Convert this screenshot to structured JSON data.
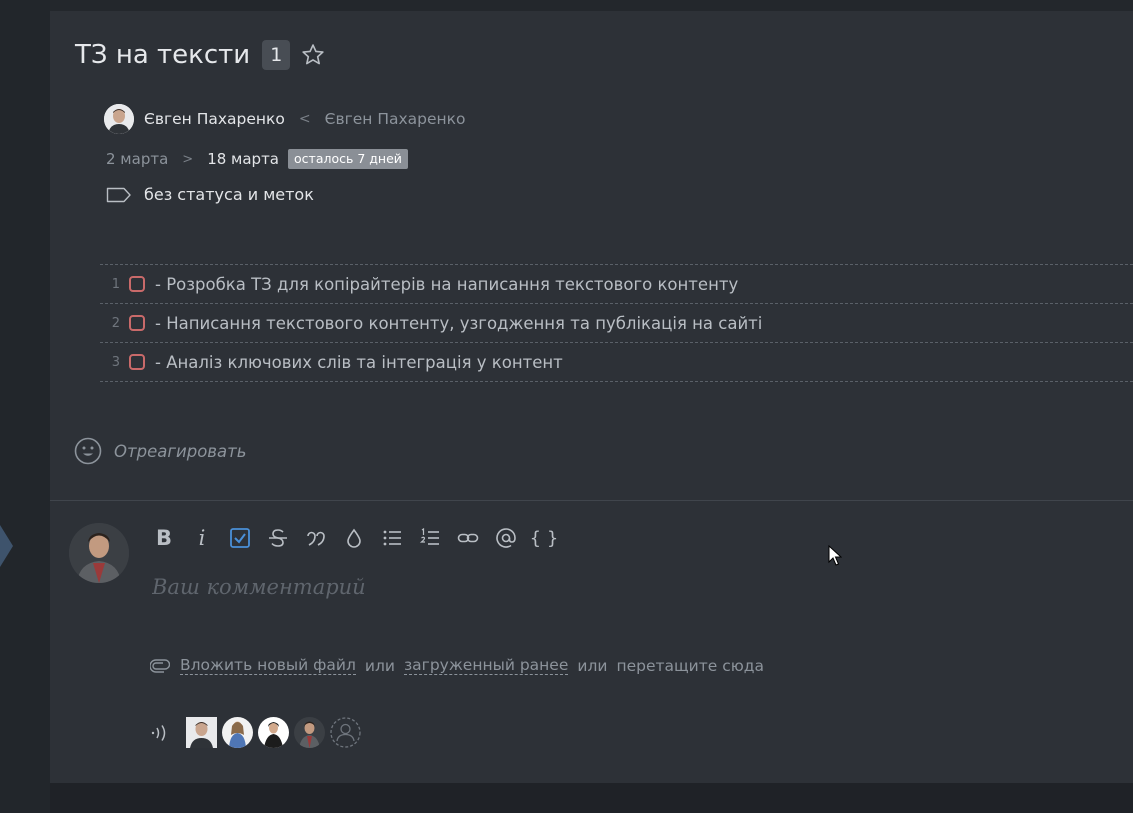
{
  "task": {
    "title": "ТЗ на тексти",
    "count": "1"
  },
  "people": {
    "author": "Євген Пахаренко",
    "separator": "<",
    "assignee": "Євген Пахаренко"
  },
  "dates": {
    "start": "2 марта",
    "separator": ">",
    "end": "18 марта",
    "remaining": "осталось 7 дней"
  },
  "status": {
    "label": "без статуса и меток"
  },
  "checklist": [
    {
      "num": "1",
      "text": "- Розробка ТЗ для копірайтерів на написання текстового контенту"
    },
    {
      "num": "2",
      "text": "- Написання текстового контенту, узгодження та публікація на сайті"
    },
    {
      "num": "3",
      "text": "- Аналіз ключових слів та інтеграція у контент"
    }
  ],
  "reaction": {
    "label": "Отреагировать"
  },
  "editor": {
    "bold": "B",
    "italic": "i",
    "braces": "{ }",
    "placeholder": "Ваш комментарий"
  },
  "attach": {
    "new_file": "Вложить новый файл",
    "or1": "или",
    "uploaded": "загруженный ранее",
    "or2": "или",
    "drag": "перетащите сюда"
  },
  "colors": {
    "accent": "#4a90d9",
    "checkbox_border": "#c96a6a",
    "card_bg": "#2d3137"
  }
}
